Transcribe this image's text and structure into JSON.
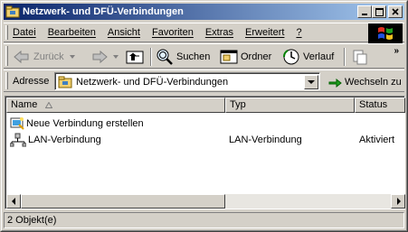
{
  "window": {
    "title": "Netzwerk- und DFÜ-Verbindungen",
    "minimize_glyph": "_",
    "maximize_glyph": "□",
    "close_glyph": "✕"
  },
  "menu": {
    "items": [
      "Datei",
      "Bearbeiten",
      "Ansicht",
      "Favoriten",
      "Extras",
      "Erweitert",
      "?"
    ]
  },
  "toolbar": {
    "back_label": "Zurück",
    "search_label": "Suchen",
    "folders_label": "Ordner",
    "history_label": "Verlauf",
    "overflow_glyph": "»"
  },
  "address": {
    "label": "Adresse",
    "value": "Netzwerk- und DFÜ-Verbindungen",
    "go_label": "Wechseln zu"
  },
  "list": {
    "columns": [
      "Name",
      "Typ",
      "Status"
    ],
    "rows": [
      {
        "name": "Neue Verbindung erstellen",
        "type": "",
        "status": "",
        "icon": "new-connection-icon"
      },
      {
        "name": "LAN-Verbindung",
        "type": "LAN-Verbindung",
        "status": "Aktiviert",
        "icon": "lan-connection-icon"
      }
    ],
    "horizontal_scroll_position": 0
  },
  "status": {
    "text": "2 Objekt(e)"
  },
  "colors": {
    "title_start": "#0a246a",
    "title_end": "#a6caf0",
    "face": "#d4d0c8"
  }
}
